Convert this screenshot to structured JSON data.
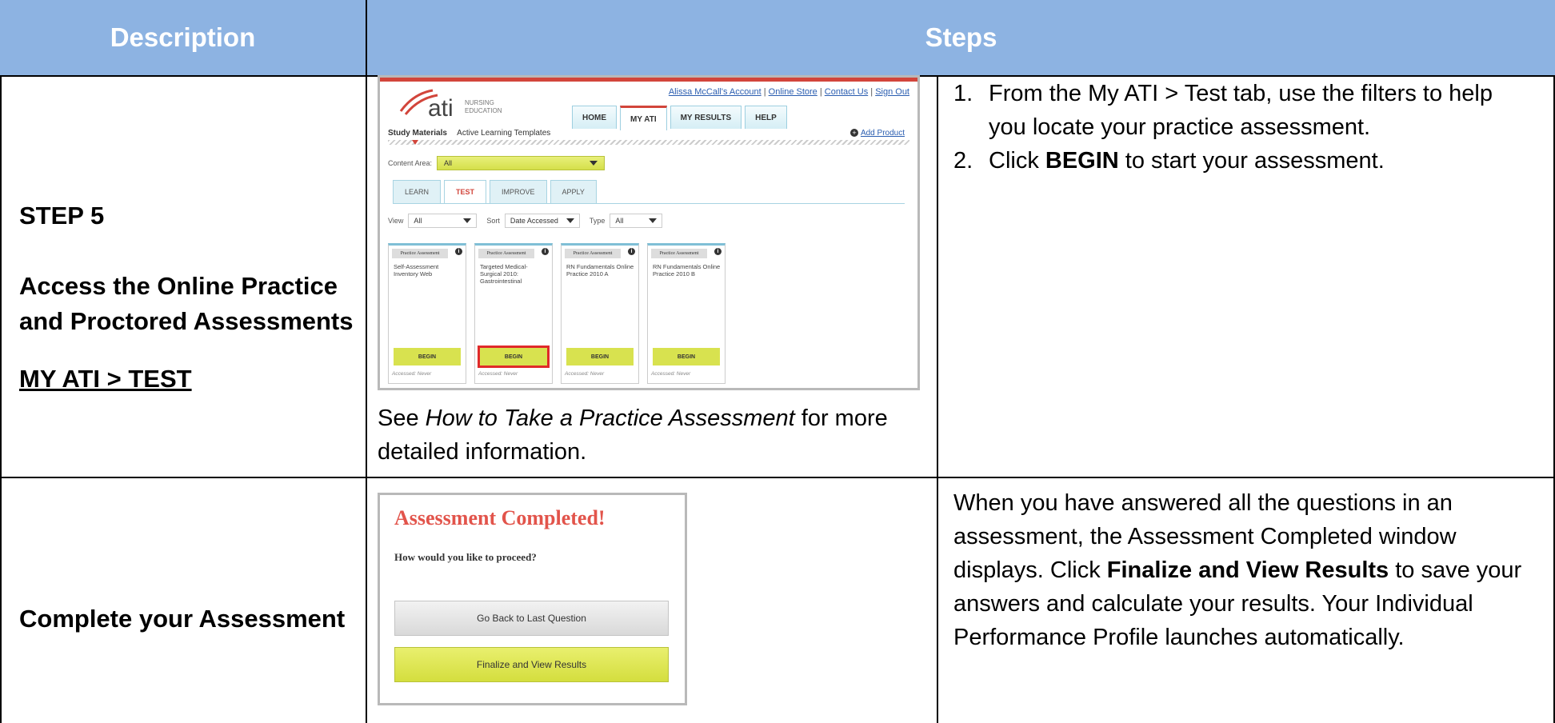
{
  "header": {
    "description": "Description",
    "steps": "Steps"
  },
  "row1": {
    "step": "STEP 5",
    "heading_line1": "Access the Online Practice",
    "heading_line2": "and Proctored Assessments",
    "link": "MY ATI > TEST",
    "note_prefix": "See ",
    "note_italic": "How to Take a Practice Assessment",
    "note_suffix": " for more",
    "note_line2": "detailed information.",
    "steps_list": [
      {
        "num": "1.",
        "line1": "From the My ATI > Test tab, use the filters to help",
        "line2": "you locate your practice assessment."
      },
      {
        "num": "2.",
        "pre": "Click ",
        "bold": "BEGIN",
        "post": " to start your assessment."
      }
    ],
    "screenshot": {
      "logo_text": "ati",
      "logo_sub1": "NURSING",
      "logo_sub2": "EDUCATION",
      "top_links": [
        "Alissa McCall's Account",
        "Online Store",
        "Contact Us",
        "Sign Out"
      ],
      "nav_tabs": [
        "HOME",
        "MY ATI",
        "MY RESULTS",
        "HELP"
      ],
      "sub_nav": [
        "Study Materials",
        "Active Learning Templates"
      ],
      "add_product": "Add Product",
      "content_area_label": "Content Area:",
      "content_area_value": "All",
      "tabs": [
        "LEARN",
        "TEST",
        "IMPROVE",
        "APPLY"
      ],
      "filter_view_label": "View",
      "filter_view_value": "All",
      "filter_sort_label": "Sort",
      "filter_sort_value": "Date Accessed",
      "filter_type_label": "Type",
      "filter_type_value": "All",
      "cards": [
        {
          "tag": "Practice Assessment",
          "title": "Self-Assessment Inventory Web",
          "button": "BEGIN",
          "accessed": "Accessed: Never"
        },
        {
          "tag": "Practice Assessment",
          "title": "Targeted Medical-Surgical 2010: Gastrointestinal",
          "button": "BEGIN",
          "accessed": "Accessed: Never"
        },
        {
          "tag": "Practice Assessment",
          "title": "RN Fundamentals Online Practice 2010 A",
          "button": "BEGIN",
          "accessed": "Accessed: Never"
        },
        {
          "tag": "Practice Assessment",
          "title": "RN Fundamentals Online Practice 2010 B",
          "button": "BEGIN",
          "accessed": "Accessed: Never"
        }
      ]
    }
  },
  "row2": {
    "heading": "Complete your Assessment",
    "dialog_title": "Assessment Completed!",
    "dialog_question": "How would you like to proceed?",
    "btn_back": "Go Back to Last Question",
    "btn_finalize": "Finalize and View Results",
    "text_l1": "When you have answered all the questions in an",
    "text_l2": "assessment, the Assessment Completed window",
    "text_l3_pre": "displays. Click ",
    "text_l3_bold": "Finalize and View Results",
    "text_l3_post": " to save your",
    "text_l4": "answers and calculate your results. Your Individual",
    "text_l5": "Performance Profile launches automatically."
  },
  "colors": {
    "header_bg": "#8DB3E2",
    "accent_red": "#D2453B",
    "lime": "#D8E24F"
  }
}
